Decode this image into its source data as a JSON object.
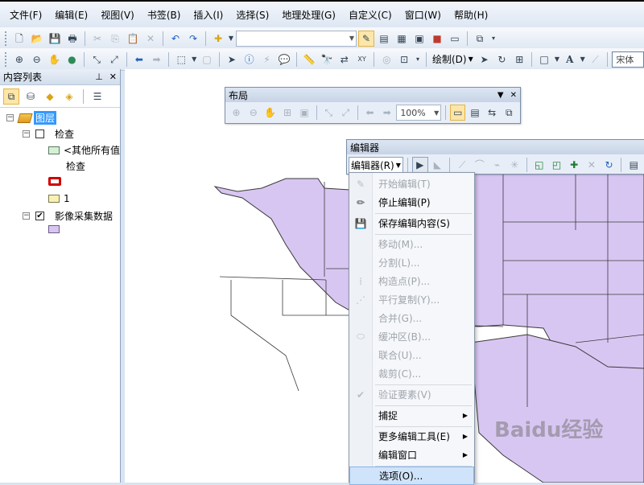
{
  "menubar": [
    "文件(F)",
    "编辑(E)",
    "视图(V)",
    "书签(B)",
    "插入(I)",
    "选择(S)",
    "地理处理(G)",
    "自定义(C)",
    "窗口(W)",
    "帮助(H)"
  ],
  "toolbar2": {
    "editor_label": "绘制(D)",
    "font_label": "宋体"
  },
  "toc": {
    "title": "内容列表",
    "layers_group": "图层",
    "layer1": "检查",
    "layer1_class_other": "<其他所有值",
    "layer1_field": "检查",
    "layer1_class_1": "1",
    "layer2": "影像采集数据"
  },
  "layout_toolbar": {
    "title": "布局",
    "zoom": "100%"
  },
  "editor_toolbar": {
    "title": "编辑器",
    "menu_label": "编辑器(R)"
  },
  "editor_menu": {
    "items": [
      {
        "label": "开始编辑(T)",
        "icon": "pencil-icon"
      },
      {
        "label": "停止编辑(P)",
        "icon": "pencil-stop-icon"
      },
      {
        "label": "保存编辑内容(S)",
        "icon": "save-edits-icon"
      },
      {
        "label": "移动(M)..."
      },
      {
        "label": "分割(L)..."
      },
      {
        "label": "构造点(P)...",
        "icon": "construct-points-icon"
      },
      {
        "label": "平行复制(Y)...",
        "icon": "copy-parallel-icon"
      },
      {
        "label": "合并(G)..."
      },
      {
        "label": "缓冲区(B)...",
        "icon": "buffer-icon"
      },
      {
        "label": "联合(U)..."
      },
      {
        "label": "裁剪(C)..."
      },
      {
        "label": "验证要素(V)",
        "icon": "validate-icon"
      },
      {
        "label": "捕捉"
      },
      {
        "label": "更多编辑工具(E)"
      },
      {
        "label": "编辑窗口"
      },
      {
        "label": "选项(O)..."
      }
    ]
  },
  "watermark": "Baidu经验",
  "colors": {
    "map_fill": "#d8c6f2",
    "map_stroke": "#3a3a3a",
    "menu_highlight": "#cfe3fa",
    "selection": "#3399ff"
  }
}
